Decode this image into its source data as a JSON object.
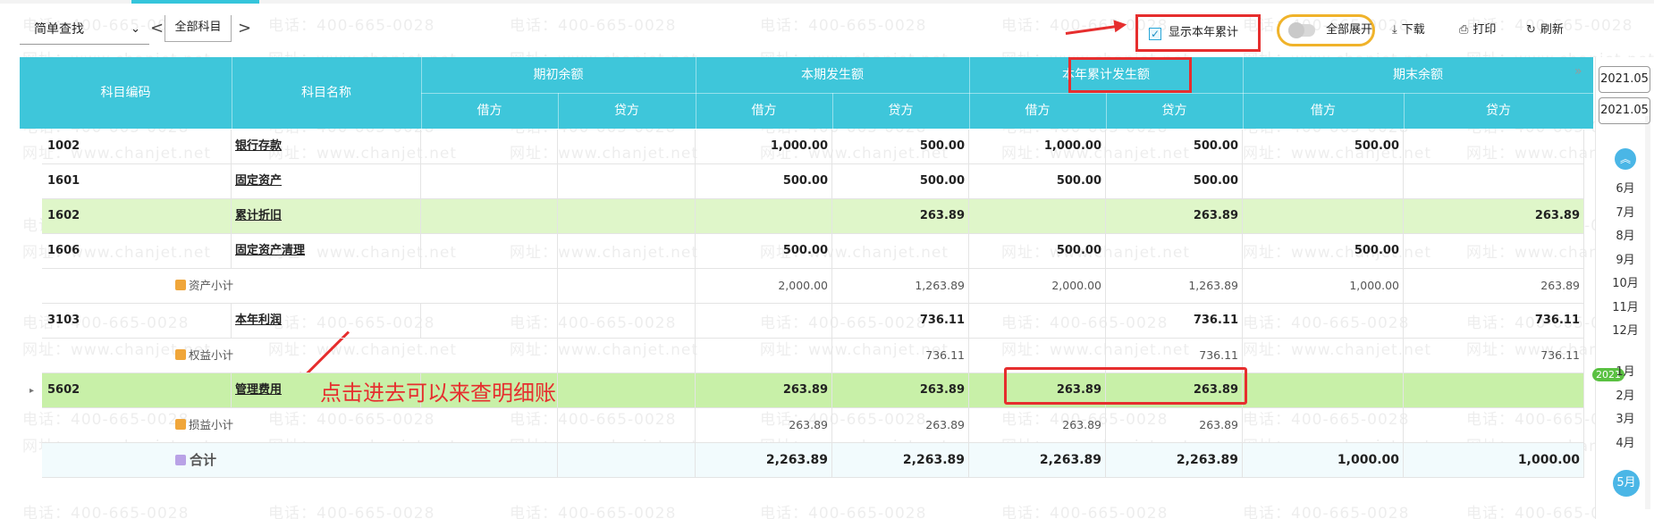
{
  "toolbar": {
    "search_mode": "简单查找",
    "prev": "<",
    "next": ">",
    "account_scope": "全部科目",
    "show_ytd_label": "显示本年累计",
    "show_ytd_check": "✓",
    "expand_all_label": "全部展开",
    "download_label": "下载",
    "print_label": "打印",
    "refresh_label": "刷新"
  },
  "table": {
    "headers": {
      "code": "科目编码",
      "name": "科目名称",
      "opening": "期初余额",
      "period": "本期发生额",
      "ytd": "本年累计发生额",
      "closing": "期末余额",
      "debit": "借方",
      "credit": "贷方"
    },
    "rows": [
      {
        "code": "1002",
        "name": "银行存款",
        "v": [
          "",
          "",
          "1,000.00",
          "500.00",
          "1,000.00",
          "500.00",
          "500.00",
          ""
        ]
      },
      {
        "code": "1601",
        "name": "固定资产",
        "v": [
          "",
          "",
          "500.00",
          "500.00",
          "500.00",
          "500.00",
          "",
          ""
        ]
      },
      {
        "code": "1602",
        "name": "累计折旧",
        "v": [
          "",
          "",
          "",
          "263.89",
          "",
          "263.89",
          "",
          "263.89"
        ]
      },
      {
        "code": "1606",
        "name": "固定资产清理",
        "v": [
          "",
          "",
          "500.00",
          "",
          "500.00",
          "",
          "500.00",
          ""
        ]
      },
      {
        "code": "",
        "name": "资产小计",
        "v": [
          "",
          "",
          "2,000.00",
          "1,263.89",
          "2,000.00",
          "1,263.89",
          "1,000.00",
          "263.89"
        ]
      },
      {
        "code": "3103",
        "name": "本年利润",
        "v": [
          "",
          "",
          "",
          "736.11",
          "",
          "736.11",
          "",
          "736.11"
        ]
      },
      {
        "code": "",
        "name": "权益小计",
        "v": [
          "",
          "",
          "",
          "736.11",
          "",
          "736.11",
          "",
          "736.11"
        ]
      },
      {
        "code": "5602",
        "name": "管理费用",
        "v": [
          "",
          "",
          "263.89",
          "263.89",
          "263.89",
          "263.89",
          "",
          ""
        ]
      },
      {
        "code": "",
        "name": "损益小计",
        "v": [
          "",
          "",
          "263.89",
          "263.89",
          "263.89",
          "263.89",
          "",
          ""
        ]
      },
      {
        "code": "",
        "name": "合计",
        "v": [
          "",
          "",
          "2,263.89",
          "2,263.89",
          "2,263.89",
          "2,263.89",
          "1,000.00",
          "1,000.00"
        ]
      }
    ]
  },
  "annotation": "点击进去可以来查明细账",
  "right_panel": {
    "date_from": "2021.05",
    "date_to": "2021.05",
    "months_before": [
      "6月",
      "7月",
      "8月",
      "9月",
      "10月",
      "11月",
      "12月"
    ],
    "year_badge": "2021",
    "months_after": [
      "1月",
      "2月",
      "3月",
      "4月"
    ],
    "active_month": "5月"
  },
  "watermark": {
    "phone": "电话：400-665-0028",
    "site": "网址：www.chanjet.net"
  }
}
